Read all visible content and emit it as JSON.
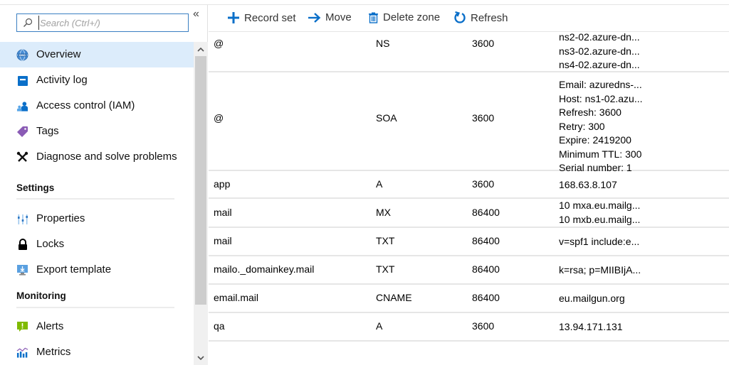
{
  "sidebar": {
    "search_placeholder": "Search (Ctrl+/)",
    "collapse_glyph": "«",
    "items": [
      {
        "label": "Overview",
        "icon": "dns-globe-icon",
        "active": true
      },
      {
        "label": "Activity log",
        "icon": "activity-log-icon"
      },
      {
        "label": "Access control (IAM)",
        "icon": "iam-people-icon"
      },
      {
        "label": "Tags",
        "icon": "tag-icon"
      },
      {
        "label": "Diagnose and solve problems",
        "icon": "wrench-screwdriver-icon"
      }
    ],
    "sections": [
      {
        "title": "Settings",
        "items": [
          {
            "label": "Properties",
            "icon": "properties-sliders-icon"
          },
          {
            "label": "Locks",
            "icon": "lock-icon"
          },
          {
            "label": "Export template",
            "icon": "export-template-icon"
          }
        ]
      },
      {
        "title": "Monitoring",
        "items": [
          {
            "label": "Alerts",
            "icon": "alert-icon"
          },
          {
            "label": "Metrics",
            "icon": "metrics-chart-icon"
          }
        ]
      }
    ],
    "scroll_up_glyph": "⌃",
    "scroll_down_glyph": "⌄"
  },
  "toolbar": {
    "record_set": "Record set",
    "move": "Move",
    "delete_zone": "Delete zone",
    "refresh": "Refresh"
  },
  "colors": {
    "accent": "#0078d4",
    "active_bg": "#dcecfb",
    "tag": "#8a5bb5",
    "alert": "#7fba00"
  },
  "records": [
    {
      "name": "@",
      "type": "NS",
      "ttl": "3600",
      "value": [
        "ns2-02.azure-dn...",
        "ns3-02.azure-dn...",
        "ns4-02.azure-dn..."
      ]
    },
    {
      "name": "@",
      "type": "SOA",
      "ttl": "3600",
      "value": [
        "Email: azuredns-...",
        "Host: ns1-02.azu...",
        "Refresh: 3600",
        "Retry: 300",
        "Expire: 2419200",
        "Minimum TTL: 300",
        "Serial number: 1"
      ]
    },
    {
      "name": "app",
      "type": "A",
      "ttl": "3600",
      "value": [
        "168.63.8.107"
      ]
    },
    {
      "name": "mail",
      "type": "MX",
      "ttl": "86400",
      "value": [
        "10 mxa.eu.mailg...",
        "10 mxb.eu.mailg..."
      ]
    },
    {
      "name": "mail",
      "type": "TXT",
      "ttl": "86400",
      "value": [
        "v=spf1 include:e..."
      ]
    },
    {
      "name": "mailo._domainkey.mail",
      "type": "TXT",
      "ttl": "86400",
      "value": [
        "k=rsa; p=MIIBIjA..."
      ]
    },
    {
      "name": "email.mail",
      "type": "CNAME",
      "ttl": "86400",
      "value": [
        "eu.mailgun.org"
      ]
    },
    {
      "name": "qa",
      "type": "A",
      "ttl": "3600",
      "value": [
        "13.94.171.131"
      ]
    }
  ]
}
